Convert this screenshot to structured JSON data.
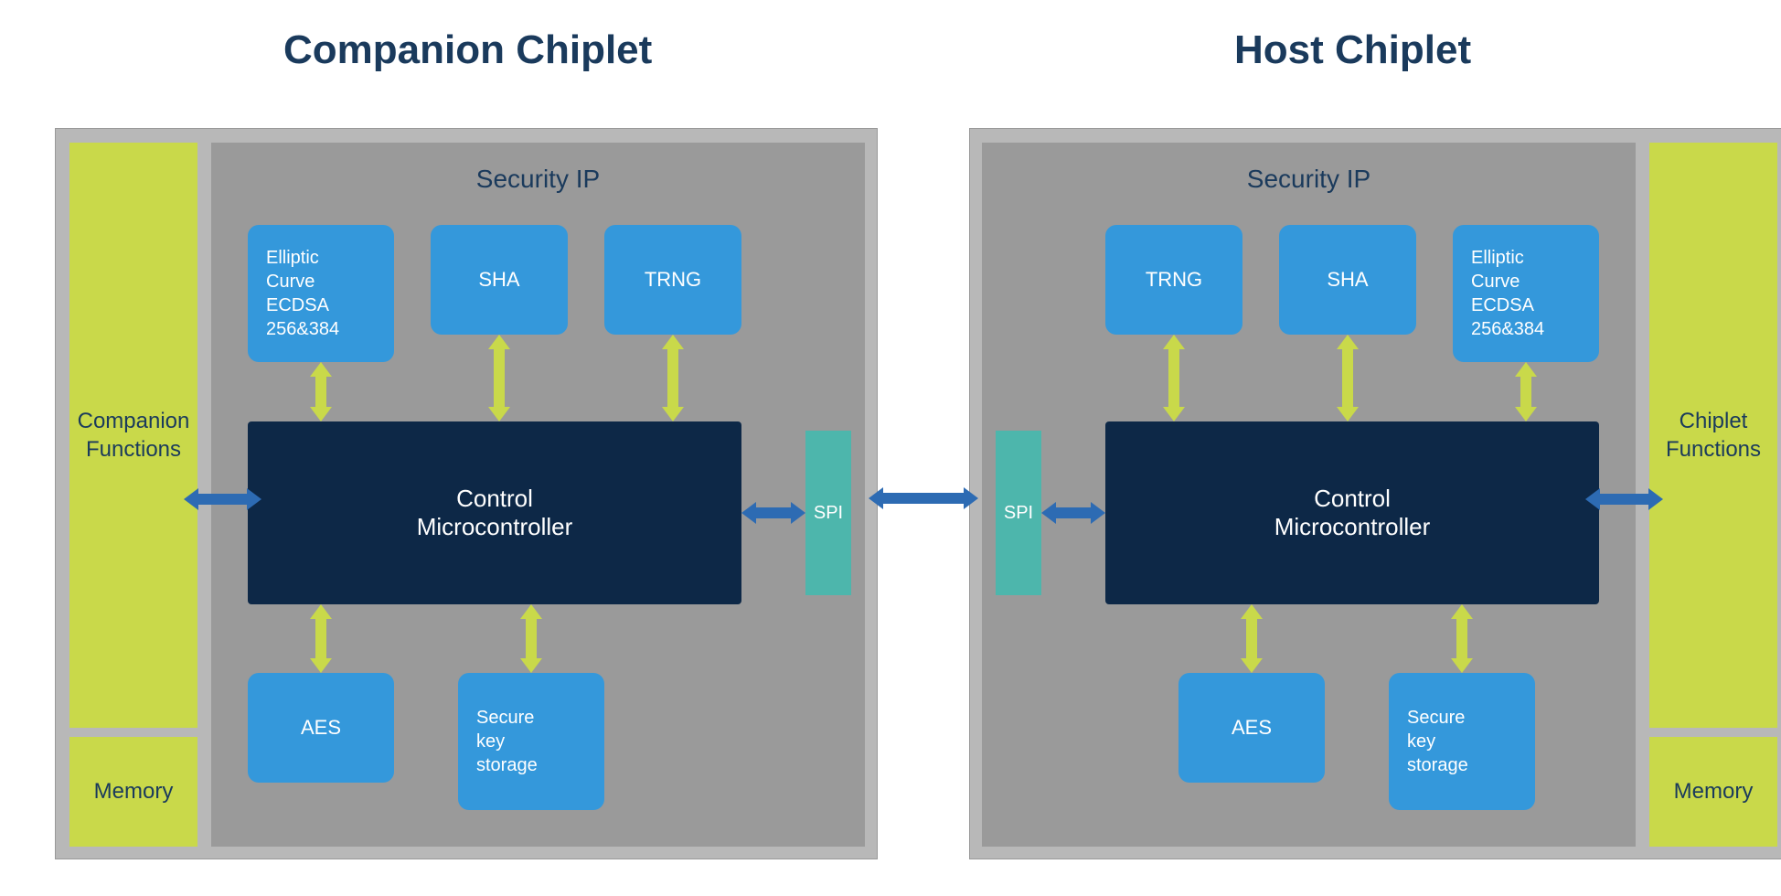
{
  "titles": {
    "companion": "Companion Chiplet",
    "host": "Host Chiplet"
  },
  "companion": {
    "functions_label": "Companion\nFunctions",
    "memory_label": "Memory",
    "security_label": "Security IP",
    "ec_label": "Elliptic\nCurve\nECDSA\n256&384",
    "sha_label": "SHA",
    "trng_label": "TRNG",
    "ctrl_line1": "Control",
    "ctrl_line2": "Microcontroller",
    "spi_label": "SPI",
    "aes_label": "AES",
    "sks_label": "Secure\nkey\nstorage"
  },
  "host": {
    "functions_label": "Chiplet\nFunctions",
    "memory_label": "Memory",
    "security_label": "Security IP",
    "ec_label": "Elliptic\nCurve\nECDSA\n256&384",
    "sha_label": "SHA",
    "trng_label": "TRNG",
    "ctrl_line1": "Control",
    "ctrl_line2": "Microcontroller",
    "spi_label": "SPI",
    "aes_label": "AES",
    "sks_label": "Secure\nkey\nstorage"
  }
}
